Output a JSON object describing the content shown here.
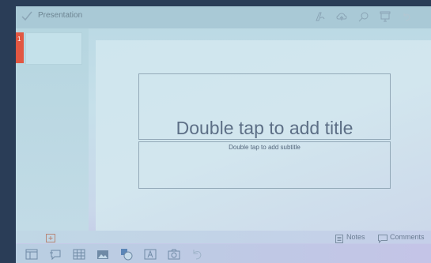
{
  "app": {
    "title": "Presentation"
  },
  "slides": [
    {
      "number": "1"
    }
  ],
  "canvas": {
    "title_placeholder": "Double tap to add title",
    "subtitle_placeholder": "Double tap to add subtitle"
  },
  "footer": {
    "notes_label": "Notes",
    "comments_label": "Comments"
  },
  "icons": {
    "titlebar": [
      "check-icon",
      "pen-icon",
      "cloud-upload-icon",
      "search-icon",
      "presentation-icon",
      "undo-icon"
    ],
    "toolbar": [
      "layout-icon",
      "comment-add-icon",
      "table-icon",
      "image-icon",
      "shapes-icon",
      "textbox-icon",
      "camera-icon",
      "undo-icon"
    ]
  },
  "colors": {
    "accent": "#e25742",
    "icon": "#8aa4b5",
    "toolbar_icon": "#6f8aa6"
  }
}
